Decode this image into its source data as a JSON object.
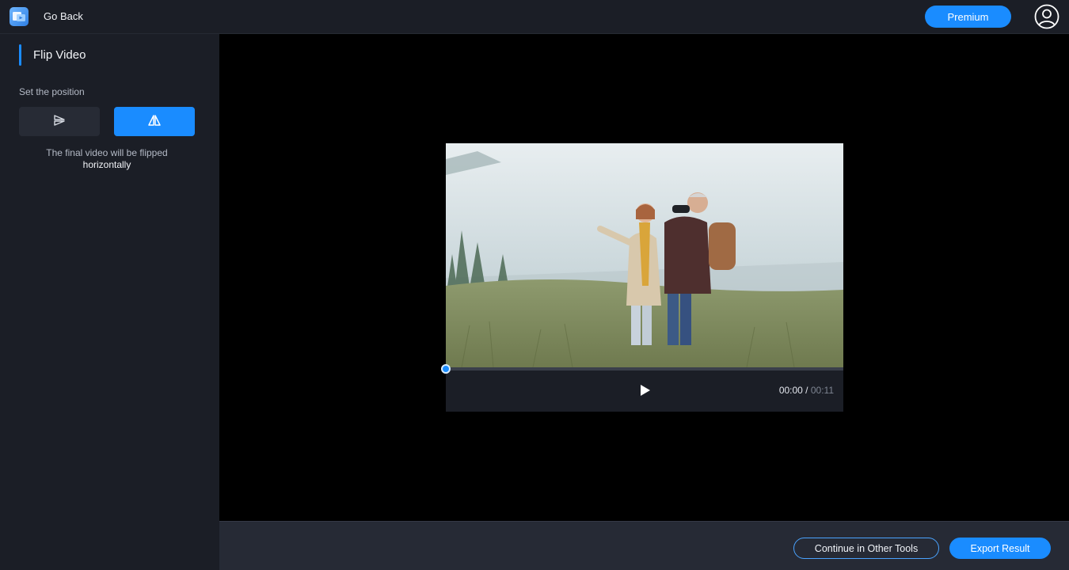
{
  "header": {
    "app_icon": "video-tool-logo-icon",
    "go_back_label": "Go Back",
    "premium_label": "Premium",
    "avatar_icon": "user-avatar-icon"
  },
  "panel": {
    "title": "Flip Video",
    "position_label": "Set the position",
    "options": [
      {
        "name": "flip-vertical",
        "icon": "flip-vertical-icon",
        "selected": false
      },
      {
        "name": "flip-horizontal",
        "icon": "flip-horizontal-icon",
        "selected": true
      }
    ],
    "info_line1": "The final video will be flipped",
    "info_line2": "horizontally"
  },
  "player": {
    "current_time": "00:00",
    "separator": " / ",
    "total_time": "00:11",
    "progress": 0,
    "play_icon": "play-icon"
  },
  "footer": {
    "continue_label": "Continue in Other Tools",
    "export_label": "Export Result"
  },
  "colors": {
    "accent": "#1a8cff",
    "panel_bg": "#1b1e26",
    "stage_bg": "#000000",
    "bottom_bg": "#262a35"
  }
}
